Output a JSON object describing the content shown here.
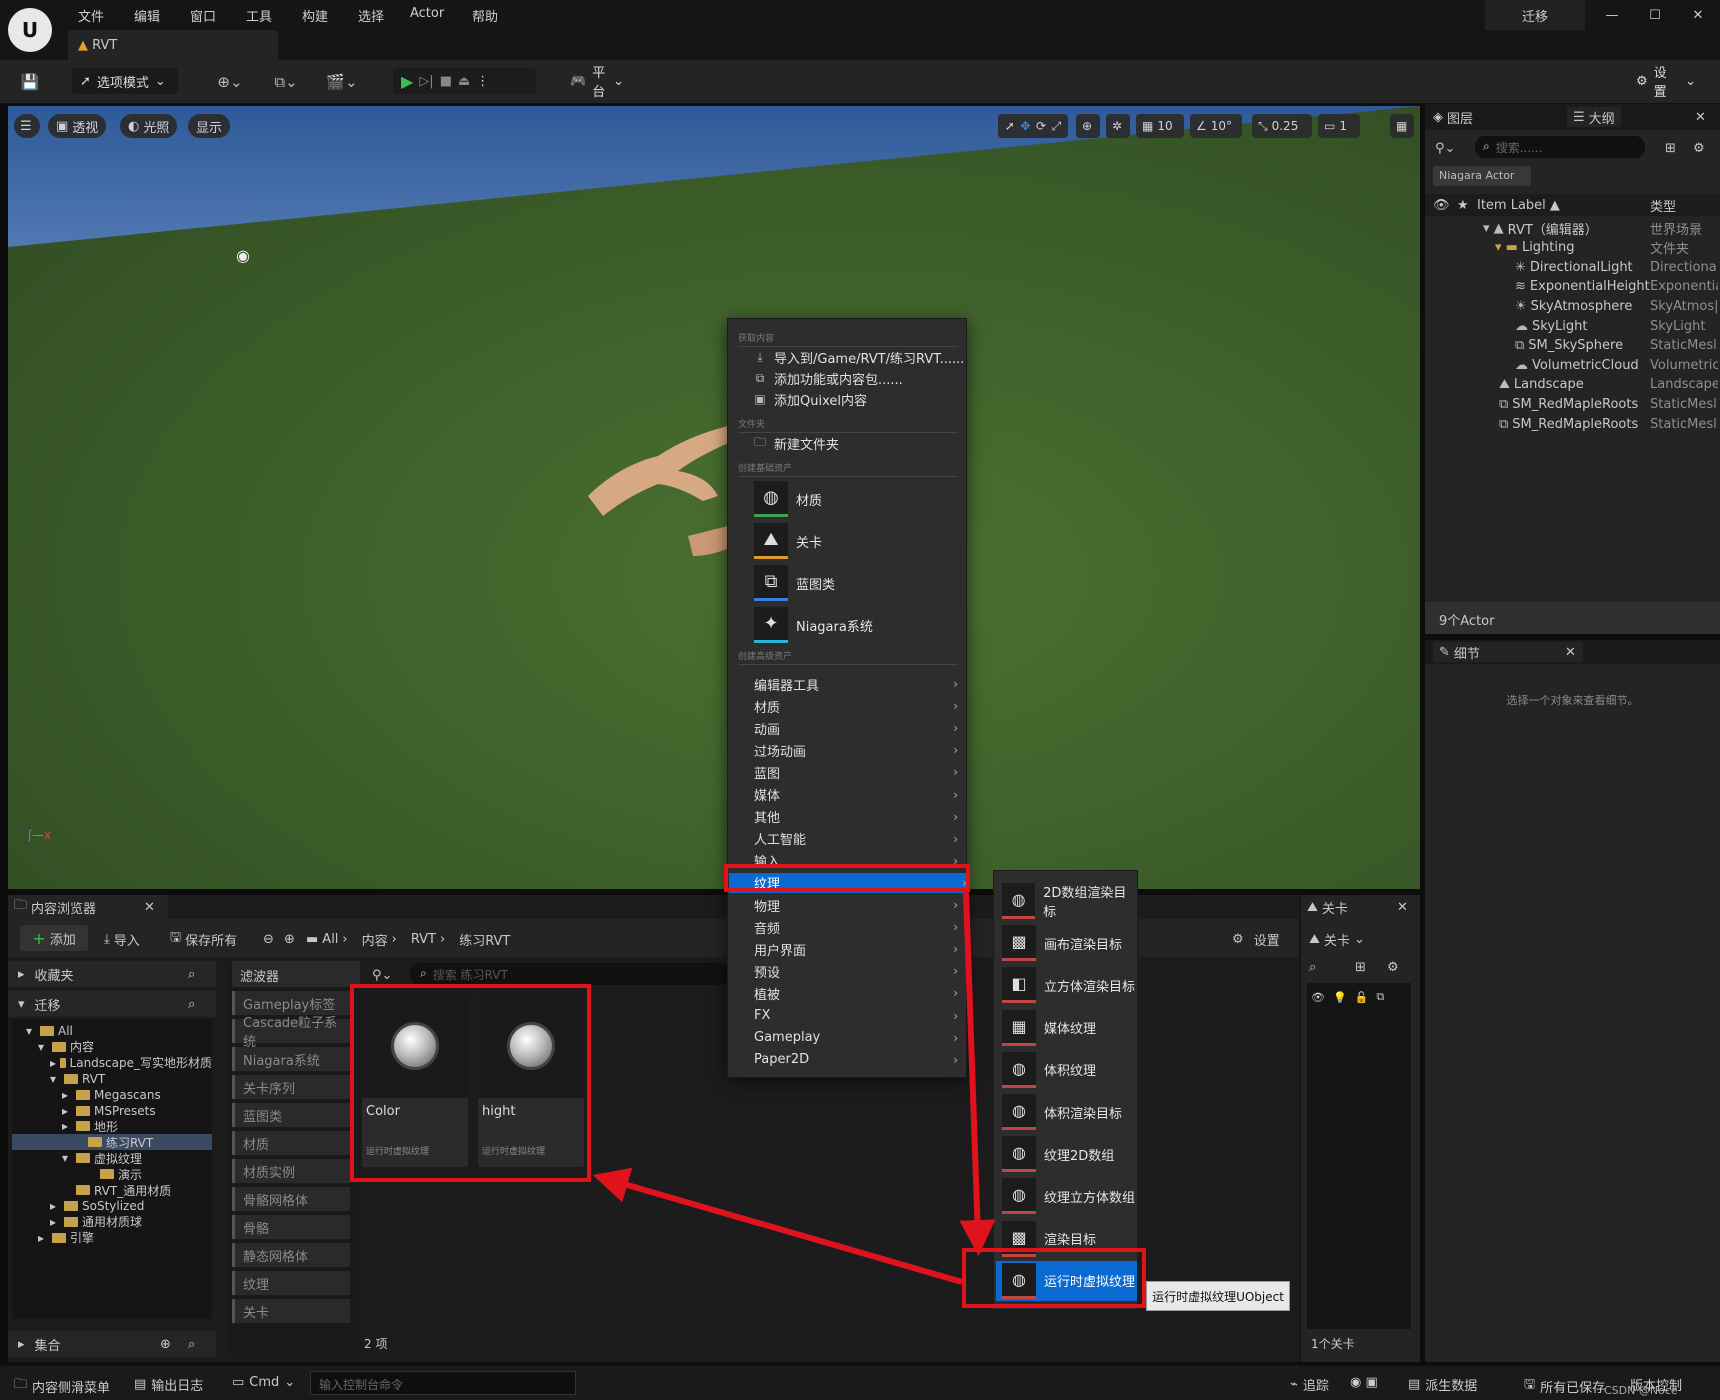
{
  "menu": {
    "items": [
      "文件",
      "编辑",
      "窗口",
      "工具",
      "构建",
      "选择",
      "Actor",
      "帮助"
    ],
    "migrate": "迁移",
    "doc_tab": "RVT"
  },
  "toolbar": {
    "mode": "选项模式",
    "platform": "平台",
    "settings": "设置"
  },
  "viewport": {
    "perspective": "透视",
    "lit": "光照",
    "show": "显示",
    "grid": "10",
    "angle": "10°",
    "scale": "0.25",
    "camera": "1"
  },
  "context_menu": {
    "sec_get": "获取内容",
    "import": "导入到/Game/RVT/练习RVT......",
    "add_feature": "添加功能或内容包......",
    "add_quixel": "添加Quixel内容",
    "sec_folder": "文件夹",
    "new_folder": "新建文件夹",
    "sec_basic": "创建基础资产",
    "basic": [
      "材质",
      "关卡",
      "蓝图类",
      "Niagara系统"
    ],
    "sec_advanced": "创建高级资产",
    "advanced": [
      "编辑器工具",
      "材质",
      "动画",
      "过场动画",
      "蓝图",
      "媒体",
      "其他",
      "人工智能",
      "输入",
      "纹理",
      "物理",
      "音频",
      "用户界面",
      "预设",
      "植被",
      "FX",
      "Gameplay",
      "Paper2D"
    ],
    "highlighted": "纹理"
  },
  "submenu": {
    "items": [
      "2D数组渲染目标",
      "画布渲染目标",
      "立方体渲染目标",
      "媒体纹理",
      "体积纹理",
      "体积渲染目标",
      "纹理2D数组",
      "纹理立方体数组",
      "渲染目标",
      "运行时虚拟纹理"
    ],
    "highlighted": "运行时虚拟纹理",
    "tooltip": "运行时虚拟纹理UObject"
  },
  "outliner": {
    "tab_layers": "图层",
    "tab_outliner": "大纲",
    "search_placeholder": "搜索......",
    "filter_chip": "Niagara Actor",
    "col_label": "Item Label ▲",
    "col_type": "类型",
    "rows": [
      {
        "label": "RVT（编辑器）",
        "type": "世界场景"
      },
      {
        "label": "Lighting",
        "type": "文件夹"
      },
      {
        "label": "DirectionalLight",
        "type": "Directional"
      },
      {
        "label": "ExponentialHeight",
        "type": "Exponentia"
      },
      {
        "label": "SkyAtmosphere",
        "type": "SkyAtmos|"
      },
      {
        "label": "SkyLight",
        "type": "SkyLight"
      },
      {
        "label": "SM_SkySphere",
        "type": "StaticMesl"
      },
      {
        "label": "VolumetricCloud",
        "type": "Volumetric"
      },
      {
        "label": "Landscape",
        "type": "Landscape"
      },
      {
        "label": "SM_RedMapleRoots",
        "type": "StaticMesl"
      },
      {
        "label": "SM_RedMapleRoots",
        "type": "StaticMesl"
      }
    ],
    "count": "9个Actor"
  },
  "details": {
    "tab": "细节",
    "empty": "选择一个对象来查看细节。"
  },
  "content_browser": {
    "tab": "内容浏览器",
    "add": "添加",
    "import": "导入",
    "save_all": "保存所有",
    "path": [
      "All",
      "内容",
      "RVT",
      "练习RVT"
    ],
    "settings": "设置",
    "favorites": "收藏夹",
    "migrate": "迁移",
    "filters_title": "滤波器",
    "search_placeholder": "搜索 练习RVT",
    "tree": [
      "All",
      "内容",
      "Landscape_写实地形材质",
      "RVT",
      "Megascans",
      "MSPresets",
      "地形",
      "练习RVT",
      "虚拟纹理",
      "演示",
      "RVT_通用材质",
      "SoStylized",
      "通用材质球",
      "引擎"
    ],
    "filters": [
      "Gameplay标签",
      "Cascade粒子系统",
      "Niagara系统",
      "关卡序列",
      "蓝图类",
      "材质",
      "材质实例",
      "骨骼网格体",
      "骨骼",
      "静态网格体",
      "纹理",
      "关卡"
    ],
    "assets": [
      {
        "name": "Color",
        "type": "运行时虚拟纹理"
      },
      {
        "name": "hight",
        "type": "运行时虚拟纹理"
      }
    ],
    "count": "2 项",
    "collections": "集合"
  },
  "levels": {
    "tab": "关卡",
    "dropdown": "关卡",
    "count": "1个关卡"
  },
  "statusbar": {
    "drawer": "内容侧滑菜单",
    "output_log": "输出日志",
    "cmd": "Cmd",
    "cmd_placeholder": "输入控制台命令",
    "trace": "追踪",
    "derived": "派生数据",
    "saved": "所有已保存",
    "source_control": "版本控制",
    "watermark": "CSDN @Noce"
  },
  "colors": {
    "accent": "#0a6ad1",
    "highlight_red": "#e0121c"
  }
}
